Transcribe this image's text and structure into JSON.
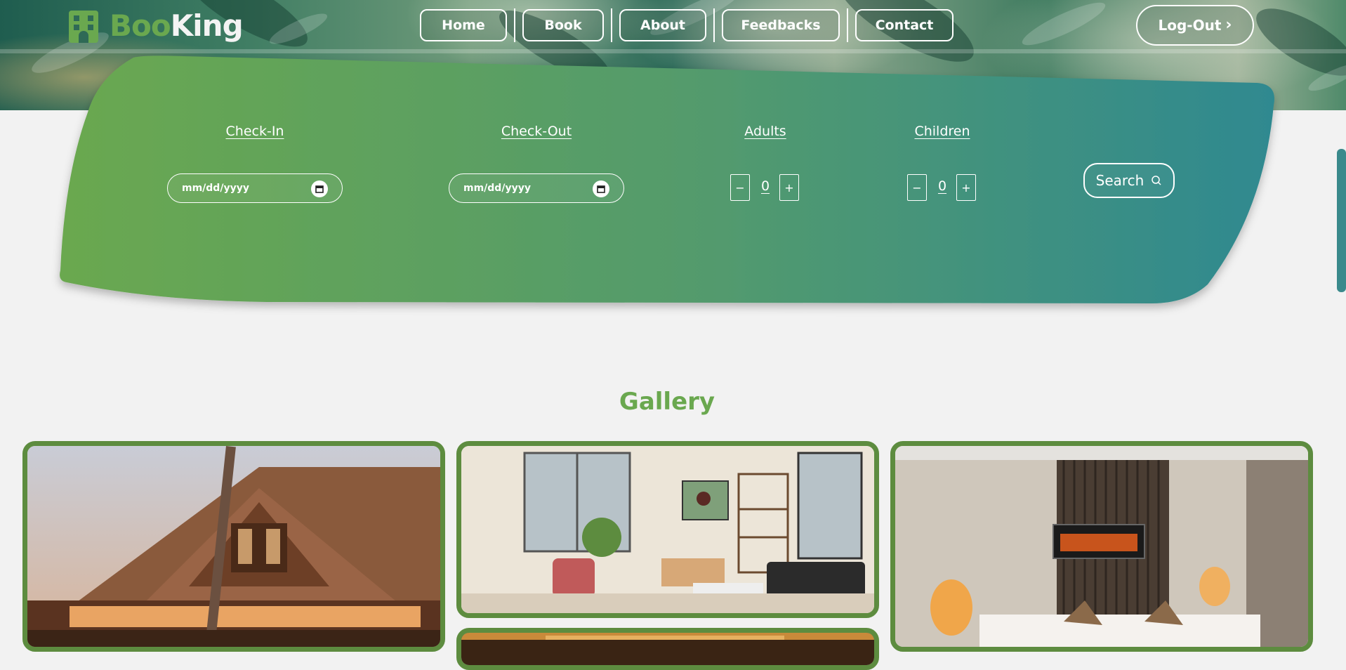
{
  "brand": {
    "logo_part1": "Boo",
    "logo_part2": "King"
  },
  "nav": {
    "items": [
      {
        "label": "Home"
      },
      {
        "label": "Book"
      },
      {
        "label": "About"
      },
      {
        "label": "Feedbacks"
      },
      {
        "label": "Contact"
      }
    ],
    "logout_label": "Log-Out"
  },
  "booking": {
    "checkin_label": "Check-In",
    "checkout_label": "Check-Out",
    "adults_label": "Adults",
    "children_label": "Children",
    "checkin_placeholder": "mm/dd/yyyy",
    "checkout_placeholder": "mm/dd/yyyy",
    "adults_value": "0",
    "children_value": "0",
    "minus": "−",
    "plus": "+",
    "search_label": "Search"
  },
  "gallery": {
    "title": "Gallery",
    "images": [
      {
        "subject": "wooden-resort-house"
      },
      {
        "subject": "living-room"
      },
      {
        "subject": "hotel-bedroom"
      },
      {
        "subject": "lounge"
      }
    ]
  },
  "colors": {
    "brand_green": "#6aa84f",
    "panel_gradient_start": "#6aa84f",
    "panel_gradient_end": "#2f8990",
    "frame_green": "#5d8c3f",
    "page_background": "#f2f2f2"
  }
}
